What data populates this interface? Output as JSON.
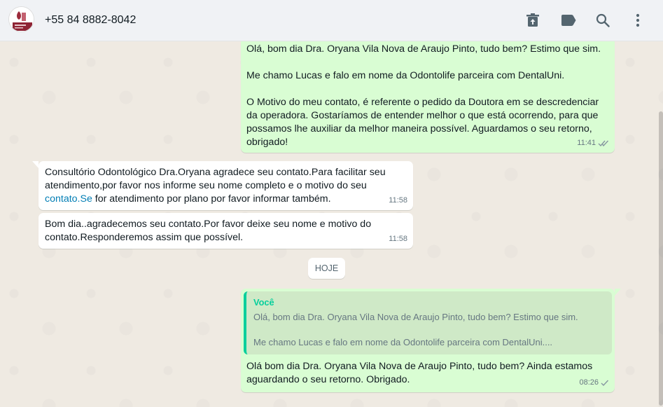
{
  "header": {
    "contact": "+55 84 8882-8042",
    "icons": [
      "delete-chat-icon",
      "label-icon",
      "search-icon",
      "menu-icon"
    ]
  },
  "colors": {
    "outgoing": "#d9fdd3",
    "incoming": "#ffffff",
    "accent": "#06cf9c",
    "ticks_read": "#8696a0",
    "link": "#027eb5"
  },
  "messages": [
    {
      "direction": "out",
      "text": "Olá, bom dia Dra. Oryana Vila Nova de Araujo Pinto, tudo bem? Estimo que sim.\n\nMe chamo Lucas e falo em nome da Odontolife parceira com DentalUni.\n\nO Motivo do meu contato, é referente o pedido da Doutora em se descredenciar da operadora. Gostaríamos de entender melhor o que está ocorrendo, para que possamos lhe auxiliar da melhor maneira possível. Aguardamos o seu retorno, obrigado!",
      "time": "11:41"
    },
    {
      "direction": "in",
      "text_before": "Consultório Odontológico Dra.Oryana agradece seu contato.Para facilitar seu atendimento,por favor nos informe seu nome completo e o motivo do seu ",
      "link": "contato.Se",
      "text_after": " for atendimento por plano por favor informar também.",
      "time": "11:58"
    },
    {
      "direction": "in",
      "text": "Bom dia..agradecemos seu contato.Por favor deixe seu nome e motivo do contato.Responderemos assim que possível.",
      "time": "11:58"
    }
  ],
  "day_separator": "HOJE",
  "reply": {
    "quote_author": "Você",
    "quote_text": "Olá, bom dia Dra. Oryana Vila Nova de Araujo Pinto, tudo bem? Estimo que sim.\n\nMe chamo Lucas e falo em nome da Odontolife parceira com DentalUni....",
    "text": "Olá bom dia Dra. Oryana Vila Nova de Araujo Pinto, tudo bem? Ainda estamos aguardando o seu retorno. Obrigado.",
    "time": "08:26"
  }
}
